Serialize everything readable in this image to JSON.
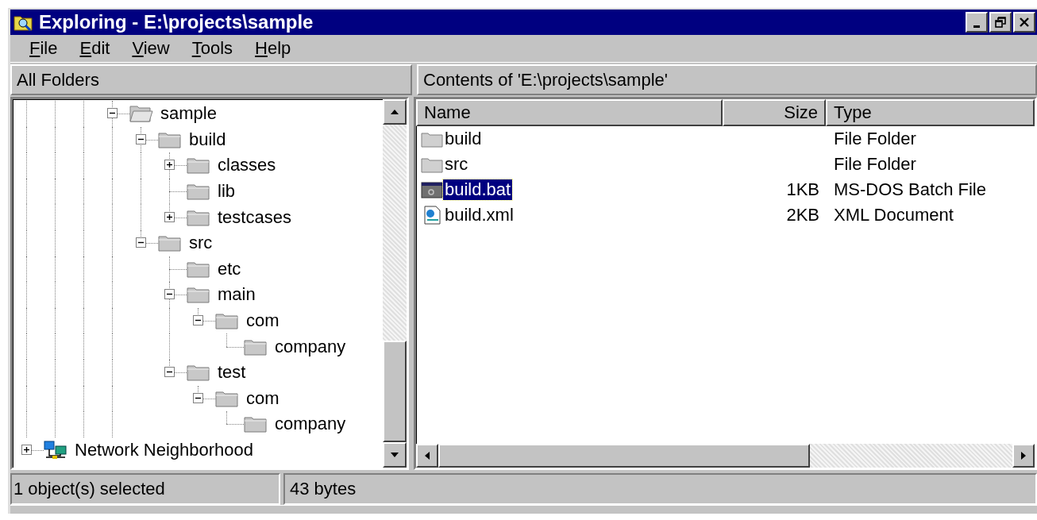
{
  "window": {
    "title": "Exploring - E:\\projects\\sample"
  },
  "menu": [
    {
      "label": "File"
    },
    {
      "label": "Edit"
    },
    {
      "label": "View"
    },
    {
      "label": "Tools"
    },
    {
      "label": "Help"
    }
  ],
  "left_header": "All Folders",
  "right_header": "Contents of 'E:\\projects\\sample'",
  "tree": [
    {
      "label": "sample",
      "kind": "open-folder",
      "expanded": true,
      "children": [
        {
          "label": "build",
          "kind": "folder",
          "expanded": true,
          "children": [
            {
              "label": "classes",
              "kind": "folder",
              "expanded": false
            },
            {
              "label": "lib",
              "kind": "folder"
            },
            {
              "label": "testcases",
              "kind": "folder",
              "expanded": false
            }
          ]
        },
        {
          "label": "src",
          "kind": "folder",
          "expanded": true,
          "children": [
            {
              "label": "etc",
              "kind": "folder"
            },
            {
              "label": "main",
              "kind": "folder",
              "expanded": true,
              "children": [
                {
                  "label": "com",
                  "kind": "folder",
                  "expanded": true,
                  "children": [
                    {
                      "label": "company",
                      "kind": "folder"
                    }
                  ]
                }
              ]
            },
            {
              "label": "test",
              "kind": "folder",
              "expanded": true,
              "children": [
                {
                  "label": "com",
                  "kind": "folder",
                  "expanded": true,
                  "children": [
                    {
                      "label": "company",
                      "kind": "folder"
                    }
                  ]
                }
              ]
            }
          ]
        }
      ]
    }
  ],
  "root_items": [
    {
      "label": "Network Neighborhood",
      "kind": "network",
      "expanded": false
    }
  ],
  "columns": [
    "Name",
    "Size",
    "Type"
  ],
  "files": [
    {
      "name": "build",
      "type": "File Folder",
      "kind": "folder",
      "selected": false
    },
    {
      "name": "src",
      "type": "File Folder",
      "kind": "folder",
      "selected": false
    },
    {
      "name": "build.bat",
      "size": "1KB",
      "type": "MS-DOS Batch File",
      "kind": "batch",
      "selected": true
    },
    {
      "name": "build.xml",
      "size": "2KB",
      "type": "XML Document",
      "kind": "xml",
      "selected": false
    }
  ],
  "status_bar": [
    "1 object(s) selected",
    "43 bytes"
  ]
}
